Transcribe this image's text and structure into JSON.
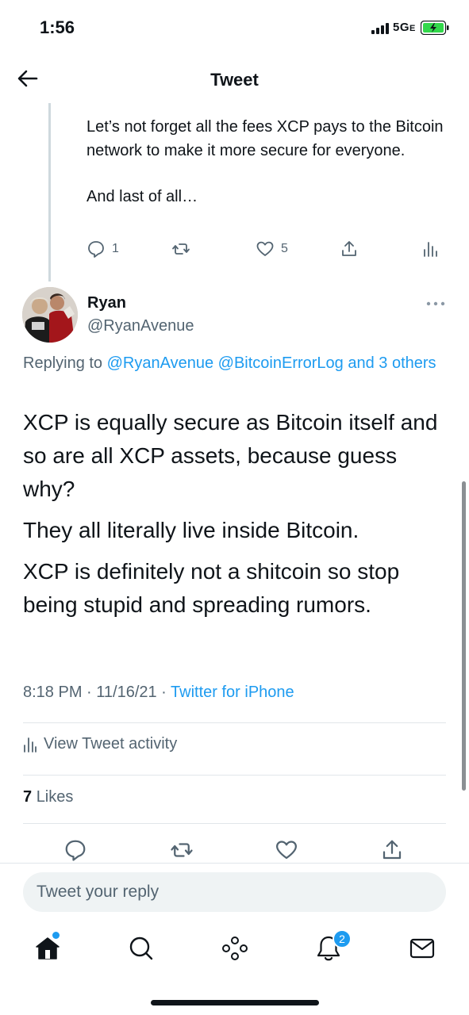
{
  "status_bar": {
    "time": "1:56",
    "network": "5G",
    "network_suffix": "E"
  },
  "header": {
    "title": "Tweet"
  },
  "previous_tweet": {
    "paragraphs": [
      "Let’s not forget all the fees XCP pays to the Bitcoin network to make it more secure for everyone.",
      "And last of all…"
    ],
    "reply_count": "1",
    "like_count": "5"
  },
  "tweet": {
    "author_name": "Ryan",
    "author_handle": "@RyanAvenue",
    "replying_prefix": "Replying to",
    "replying_mentions": "@RyanAvenue @BitcoinErrorLog and 3 others",
    "paragraphs": [
      "XCP is equally secure as Bitcoin itself and so are all XCP assets, because guess why?",
      "They all literally live inside Bitcoin.",
      "XCP is definitely not a shitcoin so stop being stupid and spreading rumors."
    ],
    "timestamp": "8:18 PM · 11/16/21 ·",
    "source": "Twitter for iPhone",
    "activity_label": "View Tweet activity",
    "likes_count": "7",
    "likes_label": "Likes"
  },
  "reply_box": {
    "placeholder": "Tweet your reply"
  },
  "tabbar": {
    "notifications_badge": "2"
  },
  "colors": {
    "accent": "#1d9bf0",
    "text_primary": "#0f1419",
    "text_secondary": "#536471",
    "battery_fill": "#32d74b"
  }
}
